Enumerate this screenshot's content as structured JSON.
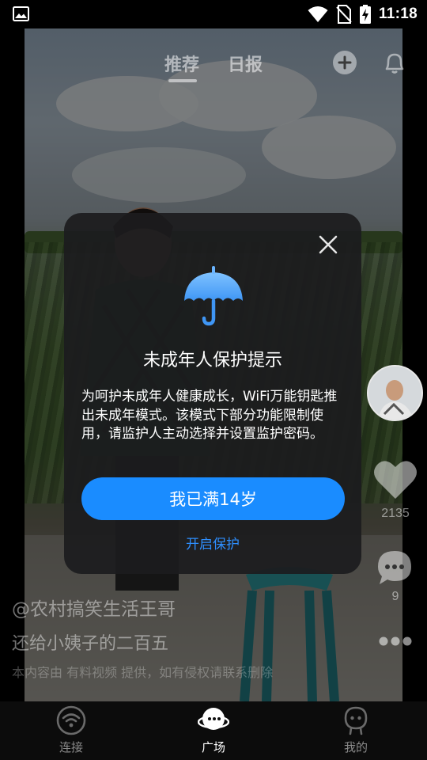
{
  "status_bar": {
    "time": "11:18",
    "icons": [
      "gallery-icon",
      "wifi-icon",
      "no-sim-icon",
      "battery-charging-icon"
    ]
  },
  "top_tabs": {
    "tabs": [
      {
        "label": "推荐",
        "active": true
      },
      {
        "label": "日报",
        "active": false
      }
    ],
    "icons": [
      "add-circle-icon",
      "bell-icon"
    ]
  },
  "side_actions": {
    "like_count": "2135",
    "comment_count": "9",
    "icons": [
      "avatar",
      "heart-icon",
      "comment-icon",
      "more-dots-icon"
    ]
  },
  "caption": {
    "author": "@农村搞笑生活王哥",
    "title": "还给小姨子的二百五",
    "source": "本内容由 有料视频 提供，如有侵权请联系删除"
  },
  "bottom_nav": {
    "items": [
      {
        "label": "连接",
        "icon": "wifi-circle-icon",
        "active": false
      },
      {
        "label": "广场",
        "icon": "planet-face-icon",
        "active": true
      },
      {
        "label": "我的",
        "icon": "profile-icon",
        "active": false
      }
    ],
    "active_color": "#ffffff",
    "inactive_color": "#8a8a8a"
  },
  "modal": {
    "title": "未成年人保护提示",
    "body": "为呵护未成年人健康成长，WiFi万能钥匙推出未成年模式。该模式下部分功能限制使用，请监护人主动选择并设置监护密码。",
    "primary_button": "我已满14岁",
    "secondary_link": "开启保护",
    "icon": "umbrella-icon",
    "close_icon": "close-icon",
    "accent_color": "#1a8cff"
  }
}
